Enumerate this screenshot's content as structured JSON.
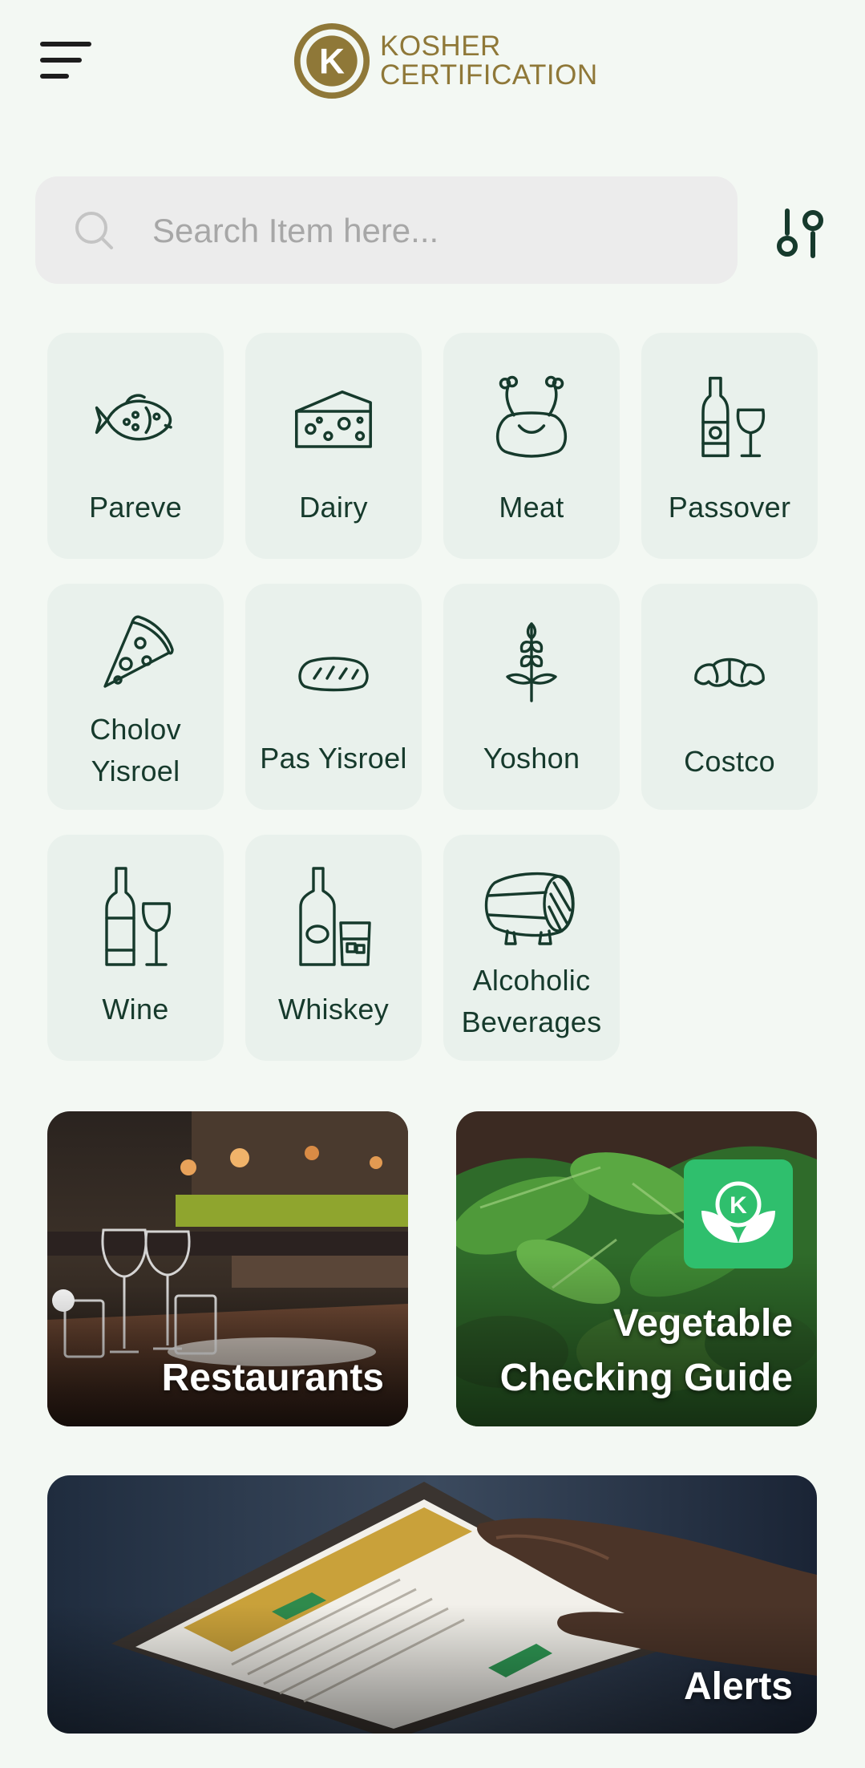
{
  "header": {
    "logo_line1": "KOSHER",
    "logo_line2": "CERTIFICATION",
    "logo_letter": "K",
    "brand_color": "#8f7838"
  },
  "search": {
    "placeholder": "Search Item here...",
    "value": ""
  },
  "categories": [
    {
      "label": "Pareve",
      "icon": "fish-icon"
    },
    {
      "label": "Dairy",
      "icon": "cheese-icon"
    },
    {
      "label": "Meat",
      "icon": "chicken-icon"
    },
    {
      "label": "Passover",
      "icon": "bottle-glass-icon"
    },
    {
      "label": "Cholov Yisroel",
      "icon": "pizza-icon"
    },
    {
      "label": "Pas Yisroel",
      "icon": "bread-icon"
    },
    {
      "label": "Yoshon",
      "icon": "wheat-icon"
    },
    {
      "label": "Costco",
      "icon": "croissant-icon"
    },
    {
      "label": "Wine",
      "icon": "wine-icon"
    },
    {
      "label": "Whiskey",
      "icon": "whiskey-icon"
    },
    {
      "label": "Alcoholic Beverages",
      "icon": "barrel-icon"
    }
  ],
  "cards": {
    "restaurants": "Restaurants",
    "vegetable": "Vegetable Checking Guide",
    "alerts": "Alerts"
  },
  "colors": {
    "accent": "#163a2c",
    "background": "#f3f8f3",
    "tile": "#e9f1ec",
    "badge": "#2fbf6d"
  }
}
